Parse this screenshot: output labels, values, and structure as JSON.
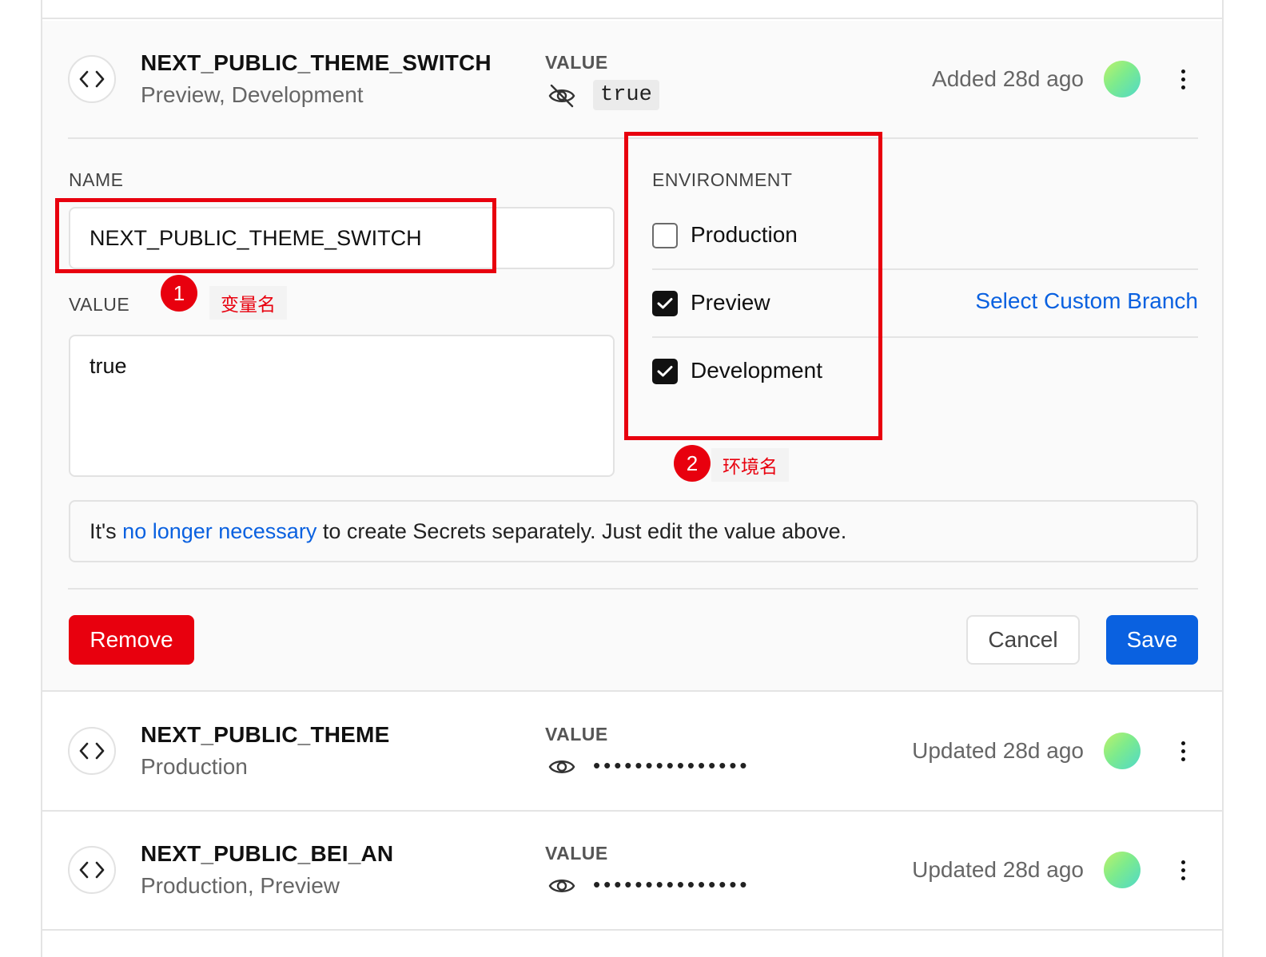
{
  "expanded_item": {
    "name": "NEXT_PUBLIC_THEME_SWITCH",
    "environments": "Preview, Development",
    "value_label": "VALUE",
    "value": "true",
    "meta": "Added 28d ago"
  },
  "editor": {
    "name_label": "NAME",
    "name_value": "NEXT_PUBLIC_THEME_SWITCH",
    "value_label": "VALUE",
    "value_text": "true",
    "environment_label": "ENVIRONMENT",
    "environments": [
      {
        "label": "Production",
        "checked": false
      },
      {
        "label": "Preview",
        "checked": true
      },
      {
        "label": "Development",
        "checked": true
      }
    ],
    "custom_branch_link": "Select Custom Branch",
    "note_prefix": "It's ",
    "note_link": "no longer necessary",
    "note_suffix": " to create Secrets separately. Just edit the value above.",
    "remove_label": "Remove",
    "cancel_label": "Cancel",
    "save_label": "Save"
  },
  "annotations": [
    {
      "number": "1",
      "text": "变量名",
      "color": "#e8000e"
    },
    {
      "number": "2",
      "text": "环境名",
      "color": "#e8000e"
    }
  ],
  "rows": [
    {
      "name": "NEXT_PUBLIC_THEME",
      "environments": "Production",
      "value_label": "VALUE",
      "masked_value": "•••••••••••••••",
      "meta": "Updated 28d ago"
    },
    {
      "name": "NEXT_PUBLIC_BEI_AN",
      "environments": "Production, Preview",
      "value_label": "VALUE",
      "masked_value": "•••••••••••••••",
      "meta": "Updated 28d ago"
    }
  ],
  "icons": {
    "code": "code-brackets-icon",
    "hidden": "eye-off-icon",
    "visible": "eye-icon",
    "more": "more-vertical-icon",
    "check": "check-icon"
  },
  "colors": {
    "accent_blue": "#0a61e0",
    "danger_red": "#e8000e"
  }
}
